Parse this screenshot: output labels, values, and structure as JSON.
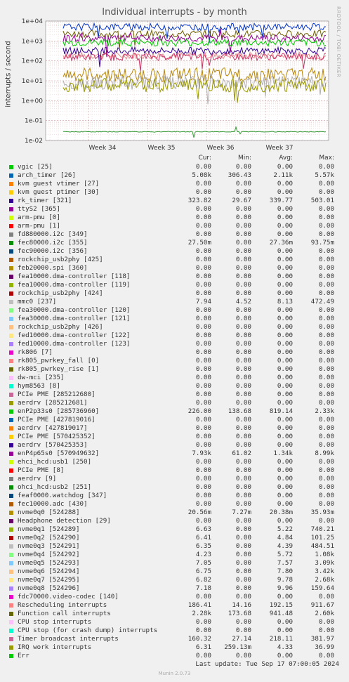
{
  "title": "Individual interrupts - by month",
  "side_label": "RRDTOOL / TOBI OETIKER",
  "last_update": "Last update: Tue Sep 17 07:00:05 2024",
  "footer": "Munin 2.0.73",
  "headers": {
    "cur": "Cur:",
    "min": "Min:",
    "avg": "Avg:",
    "max": "Max:"
  },
  "chart_data": {
    "type": "line",
    "title": "Individual interrupts - by month",
    "ylabel": "interrupts / second",
    "yscale": "log",
    "ylim": [
      0.01,
      10000
    ],
    "yticks": [
      "1e-02",
      "1e-01",
      "1e+00",
      "1e+01",
      "1e+02",
      "1e+03",
      "1e+04"
    ],
    "xticks": [
      "Week 34",
      "Week 35",
      "Week 36",
      "Week 37"
    ],
    "grid": true,
    "approx_series_levels": [
      {
        "name": "Rescheduling interrupts",
        "color": "#ea8f8f",
        "level": 186
      },
      {
        "name": "Function call interrupts",
        "color": "#705f00",
        "level": 2280
      },
      {
        "name": "Timer broadcast interrupts",
        "color": "#cc3366",
        "level": 160
      },
      {
        "name": "rk_timer [321]",
        "color": "#330099",
        "level": 324
      },
      {
        "name": "arch_timer [26]",
        "color": "#0033cc",
        "level": 5080
      },
      {
        "name": "enP4p65s0 [570949632]",
        "color": "#990099",
        "level": 1340
      },
      {
        "name": "enP2p33s0 [285736960]",
        "color": "#00cc00",
        "level": 819
      },
      {
        "name": "nvme0q0 [524288]",
        "color": "#b8860b",
        "level": 20
      },
      {
        "name": "mmc0 [237]",
        "color": "#b0b0b0",
        "level": 8
      },
      {
        "name": "IRQ work interrupts",
        "color": "#999900",
        "level": 6
      },
      {
        "name": "fec80000.i2c [355]",
        "color": "#339933",
        "level": 0.0275
      }
    ]
  },
  "legend": [
    {
      "name": "vgic [25]",
      "color": "#00cc00",
      "cur": "0.00",
      "min": "0.00",
      "avg": "0.00",
      "max": "0.00"
    },
    {
      "name": "arch_timer [26]",
      "color": "#0066b3",
      "cur": "5.08k",
      "min": "306.43",
      "avg": "2.11k",
      "max": "5.57k"
    },
    {
      "name": "kvm guest vtimer [27]",
      "color": "#ff8000",
      "cur": "0.00",
      "min": "0.00",
      "avg": "0.00",
      "max": "0.00"
    },
    {
      "name": "kvm guest ptimer [30]",
      "color": "#ffcc00",
      "cur": "0.00",
      "min": "0.00",
      "avg": "0.00",
      "max": "0.00"
    },
    {
      "name": "rk_timer [321]",
      "color": "#330099",
      "cur": "323.82",
      "min": "29.67",
      "avg": "339.77",
      "max": "503.01"
    },
    {
      "name": "ttyS2 [365]",
      "color": "#990099",
      "cur": "0.00",
      "min": "0.00",
      "avg": "0.00",
      "max": "0.00"
    },
    {
      "name": "arm-pmu [0]",
      "color": "#ccff00",
      "cur": "0.00",
      "min": "0.00",
      "avg": "0.00",
      "max": "0.00"
    },
    {
      "name": "arm-pmu [1]",
      "color": "#ff0000",
      "cur": "0.00",
      "min": "0.00",
      "avg": "0.00",
      "max": "0.00"
    },
    {
      "name": "fd880000.i2c [349]",
      "color": "#808080",
      "cur": "0.00",
      "min": "0.00",
      "avg": "0.00",
      "max": "0.00"
    },
    {
      "name": "fec80000.i2c [355]",
      "color": "#008f00",
      "cur": "27.50m",
      "min": "0.00",
      "avg": "27.36m",
      "max": "93.75m"
    },
    {
      "name": "fec90000.i2c [356]",
      "color": "#00487d",
      "cur": "0.00",
      "min": "0.00",
      "avg": "0.00",
      "max": "0.00"
    },
    {
      "name": "rockchip_usb2phy [425]",
      "color": "#b35a00",
      "cur": "0.00",
      "min": "0.00",
      "avg": "0.00",
      "max": "0.00"
    },
    {
      "name": "feb20000.spi [360]",
      "color": "#b38f00",
      "cur": "0.00",
      "min": "0.00",
      "avg": "0.00",
      "max": "0.00"
    },
    {
      "name": "fea10000.dma-controller [118]",
      "color": "#6b006b",
      "cur": "0.00",
      "min": "0.00",
      "avg": "0.00",
      "max": "0.00"
    },
    {
      "name": "fea10000.dma-controller [119]",
      "color": "#8fb300",
      "cur": "0.00",
      "min": "0.00",
      "avg": "0.00",
      "max": "0.00"
    },
    {
      "name": "rockchip_usb2phy [424]",
      "color": "#b30000",
      "cur": "0.00",
      "min": "0.00",
      "avg": "0.00",
      "max": "0.00"
    },
    {
      "name": "mmc0 [237]",
      "color": "#bebebe",
      "cur": "7.94",
      "min": "4.52",
      "avg": "8.13",
      "max": "472.49"
    },
    {
      "name": "fea30000.dma-controller [120]",
      "color": "#80ff80",
      "cur": "0.00",
      "min": "0.00",
      "avg": "0.00",
      "max": "0.00"
    },
    {
      "name": "fea30000.dma-controller [121]",
      "color": "#80c9ff",
      "cur": "0.00",
      "min": "0.00",
      "avg": "0.00",
      "max": "0.00"
    },
    {
      "name": "rockchip_usb2phy [426]",
      "color": "#ffc080",
      "cur": "0.00",
      "min": "0.00",
      "avg": "0.00",
      "max": "0.00"
    },
    {
      "name": "fed10000.dma-controller [122]",
      "color": "#ffe680",
      "cur": "0.00",
      "min": "0.00",
      "avg": "0.00",
      "max": "0.00"
    },
    {
      "name": "fed10000.dma-controller [123]",
      "color": "#aa80ff",
      "cur": "0.00",
      "min": "0.00",
      "avg": "0.00",
      "max": "0.00"
    },
    {
      "name": "rk806 [7]",
      "color": "#ee00cc",
      "cur": "0.00",
      "min": "0.00",
      "avg": "0.00",
      "max": "0.00"
    },
    {
      "name": "rk805_pwrkey_fall [0]",
      "color": "#ff8080",
      "cur": "0.00",
      "min": "0.00",
      "avg": "0.00",
      "max": "0.00"
    },
    {
      "name": "rk805_pwrkey_rise [1]",
      "color": "#666600",
      "cur": "0.00",
      "min": "0.00",
      "avg": "0.00",
      "max": "0.00"
    },
    {
      "name": "dw-mci [235]",
      "color": "#ffbfff",
      "cur": "0.00",
      "min": "0.00",
      "avg": "0.00",
      "max": "0.00"
    },
    {
      "name": "hym8563 [8]",
      "color": "#00ffcc",
      "cur": "0.00",
      "min": "0.00",
      "avg": "0.00",
      "max": "0.00"
    },
    {
      "name": "PCIe PME [285212680]",
      "color": "#cc6699",
      "cur": "0.00",
      "min": "0.00",
      "avg": "0.00",
      "max": "0.00"
    },
    {
      "name": "aerdrv [285212681]",
      "color": "#999900",
      "cur": "0.00",
      "min": "0.00",
      "avg": "0.00",
      "max": "0.00"
    },
    {
      "name": "enP2p33s0 [285736960]",
      "color": "#00cc00",
      "cur": "226.00",
      "min": "138.68",
      "avg": "819.14",
      "max": "2.33k"
    },
    {
      "name": "PCIe PME [427819016]",
      "color": "#0066b3",
      "cur": "0.00",
      "min": "0.00",
      "avg": "0.00",
      "max": "0.00"
    },
    {
      "name": "aerdrv [427819017]",
      "color": "#ff8000",
      "cur": "0.00",
      "min": "0.00",
      "avg": "0.00",
      "max": "0.00"
    },
    {
      "name": "PCIe PME [570425352]",
      "color": "#ffcc00",
      "cur": "0.00",
      "min": "0.00",
      "avg": "0.00",
      "max": "0.00"
    },
    {
      "name": "aerdrv [570425353]",
      "color": "#330099",
      "cur": "0.00",
      "min": "0.00",
      "avg": "0.00",
      "max": "0.00"
    },
    {
      "name": "enP4p65s0 [570949632]",
      "color": "#990099",
      "cur": "7.93k",
      "min": "61.02",
      "avg": "1.34k",
      "max": "8.99k"
    },
    {
      "name": "ehci_hcd:usb1 [250]",
      "color": "#ccff00",
      "cur": "0.00",
      "min": "0.00",
      "avg": "0.00",
      "max": "0.00"
    },
    {
      "name": "PCIe PME [8]",
      "color": "#ff0000",
      "cur": "0.00",
      "min": "0.00",
      "avg": "0.00",
      "max": "0.00"
    },
    {
      "name": "aerdrv [9]",
      "color": "#808080",
      "cur": "0.00",
      "min": "0.00",
      "avg": "0.00",
      "max": "0.00"
    },
    {
      "name": "ohci_hcd:usb2 [251]",
      "color": "#008f00",
      "cur": "0.00",
      "min": "0.00",
      "avg": "0.00",
      "max": "0.00"
    },
    {
      "name": "feaf0000.watchdog [347]",
      "color": "#00487d",
      "cur": "0.00",
      "min": "0.00",
      "avg": "0.00",
      "max": "0.00"
    },
    {
      "name": "fec10000.adc [430]",
      "color": "#b35a00",
      "cur": "0.00",
      "min": "0.00",
      "avg": "0.00",
      "max": "0.00"
    },
    {
      "name": "nvme0q0 [524288]",
      "color": "#b38f00",
      "cur": "20.56m",
      "min": "7.27m",
      "avg": "20.38m",
      "max": "35.93m"
    },
    {
      "name": "Headphone detection [29]",
      "color": "#6b006b",
      "cur": "0.00",
      "min": "0.00",
      "avg": "0.00",
      "max": "0.00"
    },
    {
      "name": "nvme0q1 [524289]",
      "color": "#8fb300",
      "cur": "6.63",
      "min": "0.00",
      "avg": "5.22",
      "max": "740.21"
    },
    {
      "name": "nvme0q2 [524290]",
      "color": "#b30000",
      "cur": "6.41",
      "min": "0.00",
      "avg": "4.84",
      "max": "101.25"
    },
    {
      "name": "nvme0q3 [524291]",
      "color": "#bebebe",
      "cur": "6.35",
      "min": "0.00",
      "avg": "4.39",
      "max": "484.51"
    },
    {
      "name": "nvme0q4 [524292]",
      "color": "#80ff80",
      "cur": "4.23",
      "min": "0.00",
      "avg": "5.72",
      "max": "1.08k"
    },
    {
      "name": "nvme0q5 [524293]",
      "color": "#80c9ff",
      "cur": "7.05",
      "min": "0.00",
      "avg": "7.57",
      "max": "3.09k"
    },
    {
      "name": "nvme0q6 [524294]",
      "color": "#ffc080",
      "cur": "6.75",
      "min": "0.00",
      "avg": "7.80",
      "max": "3.42k"
    },
    {
      "name": "nvme0q7 [524295]",
      "color": "#ffe680",
      "cur": "6.82",
      "min": "0.00",
      "avg": "9.78",
      "max": "2.68k"
    },
    {
      "name": "nvme0q8 [524296]",
      "color": "#aa80ff",
      "cur": "7.18",
      "min": "0.00",
      "avg": "9.96",
      "max": "159.64"
    },
    {
      "name": "fdc70000.video-codec [140]",
      "color": "#ee00cc",
      "cur": "0.00",
      "min": "0.00",
      "avg": "0.00",
      "max": "0.00"
    },
    {
      "name": "Rescheduling interrupts",
      "color": "#ff8080",
      "cur": "186.41",
      "min": "14.16",
      "avg": "192.15",
      "max": "911.67"
    },
    {
      "name": "Function call interrupts",
      "color": "#666600",
      "cur": "2.28k",
      "min": "173.68",
      "avg": "941.48",
      "max": "2.60k"
    },
    {
      "name": "CPU stop interrupts",
      "color": "#ffbfff",
      "cur": "0.00",
      "min": "0.00",
      "avg": "0.00",
      "max": "0.00"
    },
    {
      "name": "CPU stop (for crash dump) interrupts",
      "color": "#00ffcc",
      "cur": "0.00",
      "min": "0.00",
      "avg": "0.00",
      "max": "0.00"
    },
    {
      "name": "Timer broadcast interrupts",
      "color": "#cc6699",
      "cur": "160.32",
      "min": "27.14",
      "avg": "218.11",
      "max": "381.97"
    },
    {
      "name": "IRQ work interrupts",
      "color": "#999900",
      "cur": "6.31",
      "min": "259.13m",
      "avg": "4.33",
      "max": "36.99"
    },
    {
      "name": "Err",
      "color": "#00cc00",
      "cur": "0.00",
      "min": "0.00",
      "avg": "0.00",
      "max": "0.00"
    }
  ]
}
